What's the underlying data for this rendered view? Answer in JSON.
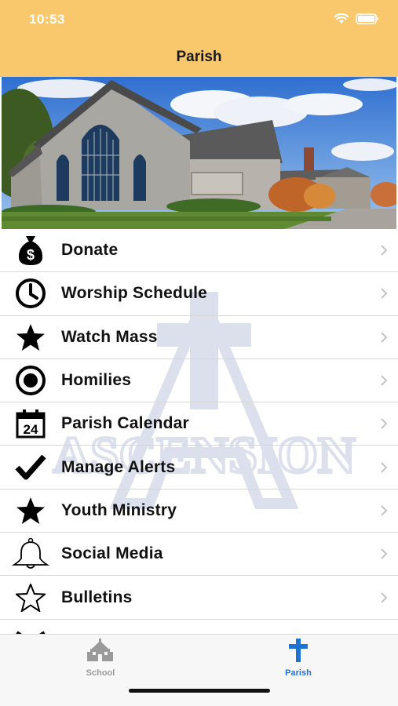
{
  "status": {
    "time": "10:53"
  },
  "header": {
    "title": "Parish"
  },
  "menu": {
    "items": [
      {
        "label": "Donate",
        "icon": "money-bag-icon"
      },
      {
        "label": "Worship Schedule",
        "icon": "clock-icon"
      },
      {
        "label": "Watch Mass",
        "icon": "star-icon"
      },
      {
        "label": "Homilies",
        "icon": "record-icon"
      },
      {
        "label": "Parish Calendar",
        "icon": "calendar-icon",
        "calendar_day": "24"
      },
      {
        "label": "Manage Alerts",
        "icon": "checkmark-icon"
      },
      {
        "label": "Youth Ministry",
        "icon": "star-icon"
      },
      {
        "label": "Social Media",
        "icon": "bell-icon"
      },
      {
        "label": "Bulletins",
        "icon": "star-outline-icon"
      }
    ]
  },
  "watermark": {
    "text": "ASCENSION"
  },
  "tabbar": {
    "tabs": [
      {
        "label": "School",
        "icon": "schoolhouse-icon",
        "selected": false
      },
      {
        "label": "Parish",
        "icon": "cross-icon",
        "selected": true
      }
    ]
  },
  "colors": {
    "header_bg": "#fac86c",
    "active_tab": "#1d72d6",
    "inactive_tab": "#9a9a9a"
  }
}
